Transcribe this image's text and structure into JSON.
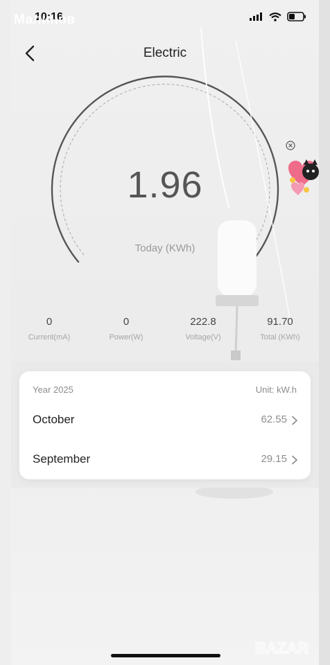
{
  "status_bar": {
    "time": "10:16",
    "watermark": "Малинов"
  },
  "header": {
    "title": "Electric"
  },
  "gauge": {
    "value": "1.96",
    "label": "Today (KWh)"
  },
  "stats": [
    {
      "value": "0",
      "label": "Current(mA)"
    },
    {
      "value": "0",
      "label": "Power(W)"
    },
    {
      "value": "222.8",
      "label": "Voltage(V)"
    },
    {
      "value": "91.70",
      "label": "Total (KWh)"
    }
  ],
  "history": {
    "year_label": "Year 2025",
    "unit_label": "Unit: kW.h",
    "months": [
      {
        "name": "October",
        "value": "62.55"
      },
      {
        "name": "September",
        "value": "29.15"
      }
    ]
  },
  "watermark_bottom": "BAZAR",
  "colors": {
    "gauge_arc": "#555555",
    "value_text": "#555555",
    "label_text": "#9a9a9a"
  },
  "icons": [
    "signal-icon",
    "wifi-icon",
    "battery-icon",
    "back-arrow-icon",
    "close-circle-icon",
    "chevron-right-icon"
  ]
}
